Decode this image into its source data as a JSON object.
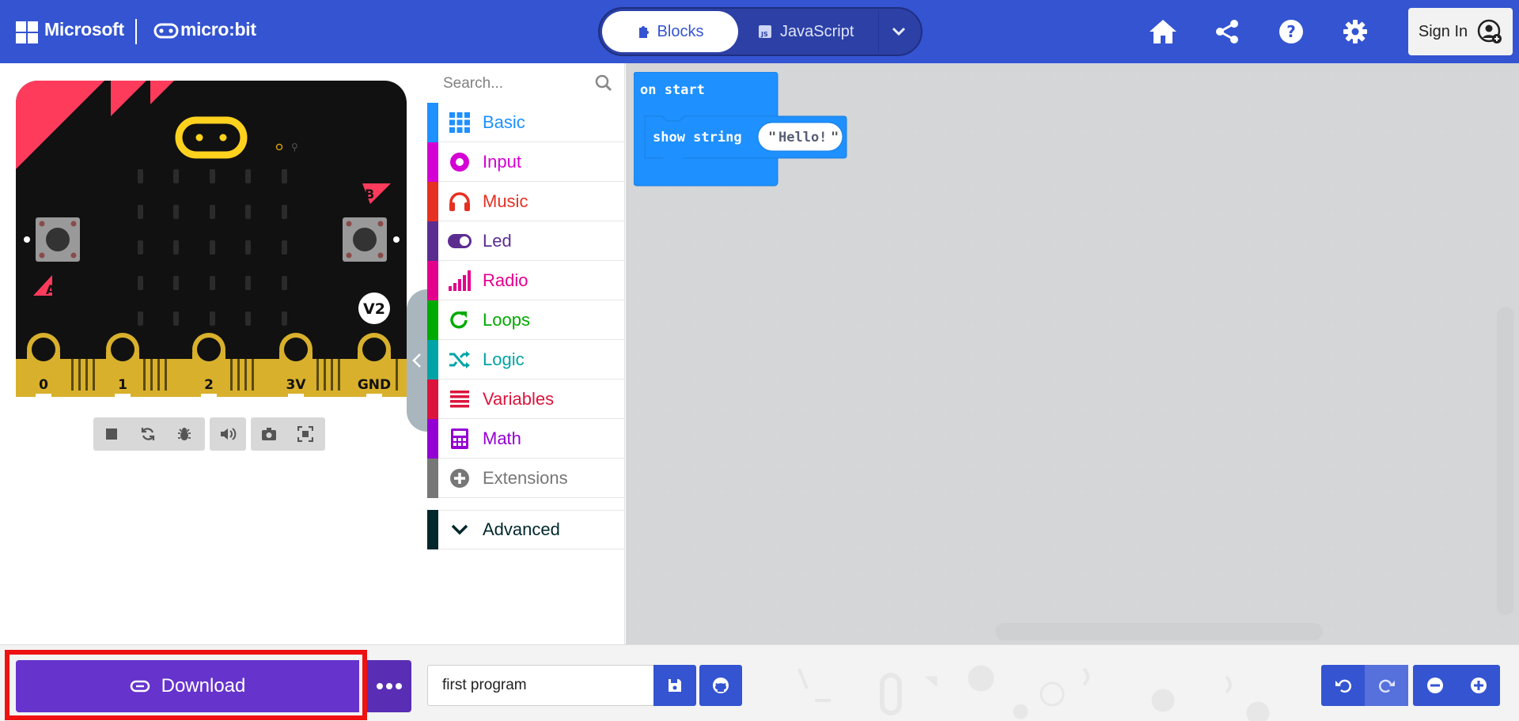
{
  "header": {
    "brand": "Microsoft",
    "product": "micro:bit",
    "tabs": [
      {
        "label": "Blocks",
        "icon": "puzzle-icon",
        "active": true
      },
      {
        "label": "JavaScript",
        "icon": "js-icon",
        "active": false
      }
    ],
    "icons": [
      "home-icon",
      "share-icon",
      "help-icon",
      "gear-icon"
    ],
    "signin_label": "Sign In",
    "color": "#3454d1"
  },
  "simulator": {
    "pins": [
      "0",
      "1",
      "2",
      "3V",
      "GND"
    ],
    "button_a": "A",
    "button_b": "B",
    "version_badge": "V2",
    "controls": [
      "stop-icon",
      "restart-icon",
      "debug-icon",
      "sound-icon",
      "screenshot-icon",
      "fullscreen-icon"
    ]
  },
  "toolbox": {
    "search_placeholder": "Search...",
    "categories": [
      {
        "label": "Basic",
        "color": "#1e90ff",
        "icon": "grid-icon"
      },
      {
        "label": "Input",
        "color": "#d400d4",
        "icon": "target-icon"
      },
      {
        "label": "Music",
        "color": "#e63022",
        "icon": "headphones-icon"
      },
      {
        "label": "Led",
        "color": "#5c2d91",
        "icon": "toggle-icon"
      },
      {
        "label": "Radio",
        "color": "#e3008c",
        "icon": "signal-bars-icon"
      },
      {
        "label": "Loops",
        "color": "#00aa00",
        "icon": "loop-arrow-icon"
      },
      {
        "label": "Logic",
        "color": "#00a4a6",
        "icon": "shuffle-icon"
      },
      {
        "label": "Variables",
        "color": "#dc143c",
        "icon": "lines-icon"
      },
      {
        "label": "Math",
        "color": "#9400d3",
        "icon": "calculator-icon"
      },
      {
        "label": "Extensions",
        "color": "#777777",
        "icon": "plus-circle-icon"
      },
      {
        "label": "Advanced",
        "color": "#00272b",
        "icon": "chevron-down-icon"
      }
    ]
  },
  "workspace": {
    "event_block": "on start",
    "statement_block": "show string",
    "string_value": "Hello!",
    "block_color": "#1e90ff"
  },
  "bottombar": {
    "download_label": "Download",
    "project_name": "first program"
  }
}
